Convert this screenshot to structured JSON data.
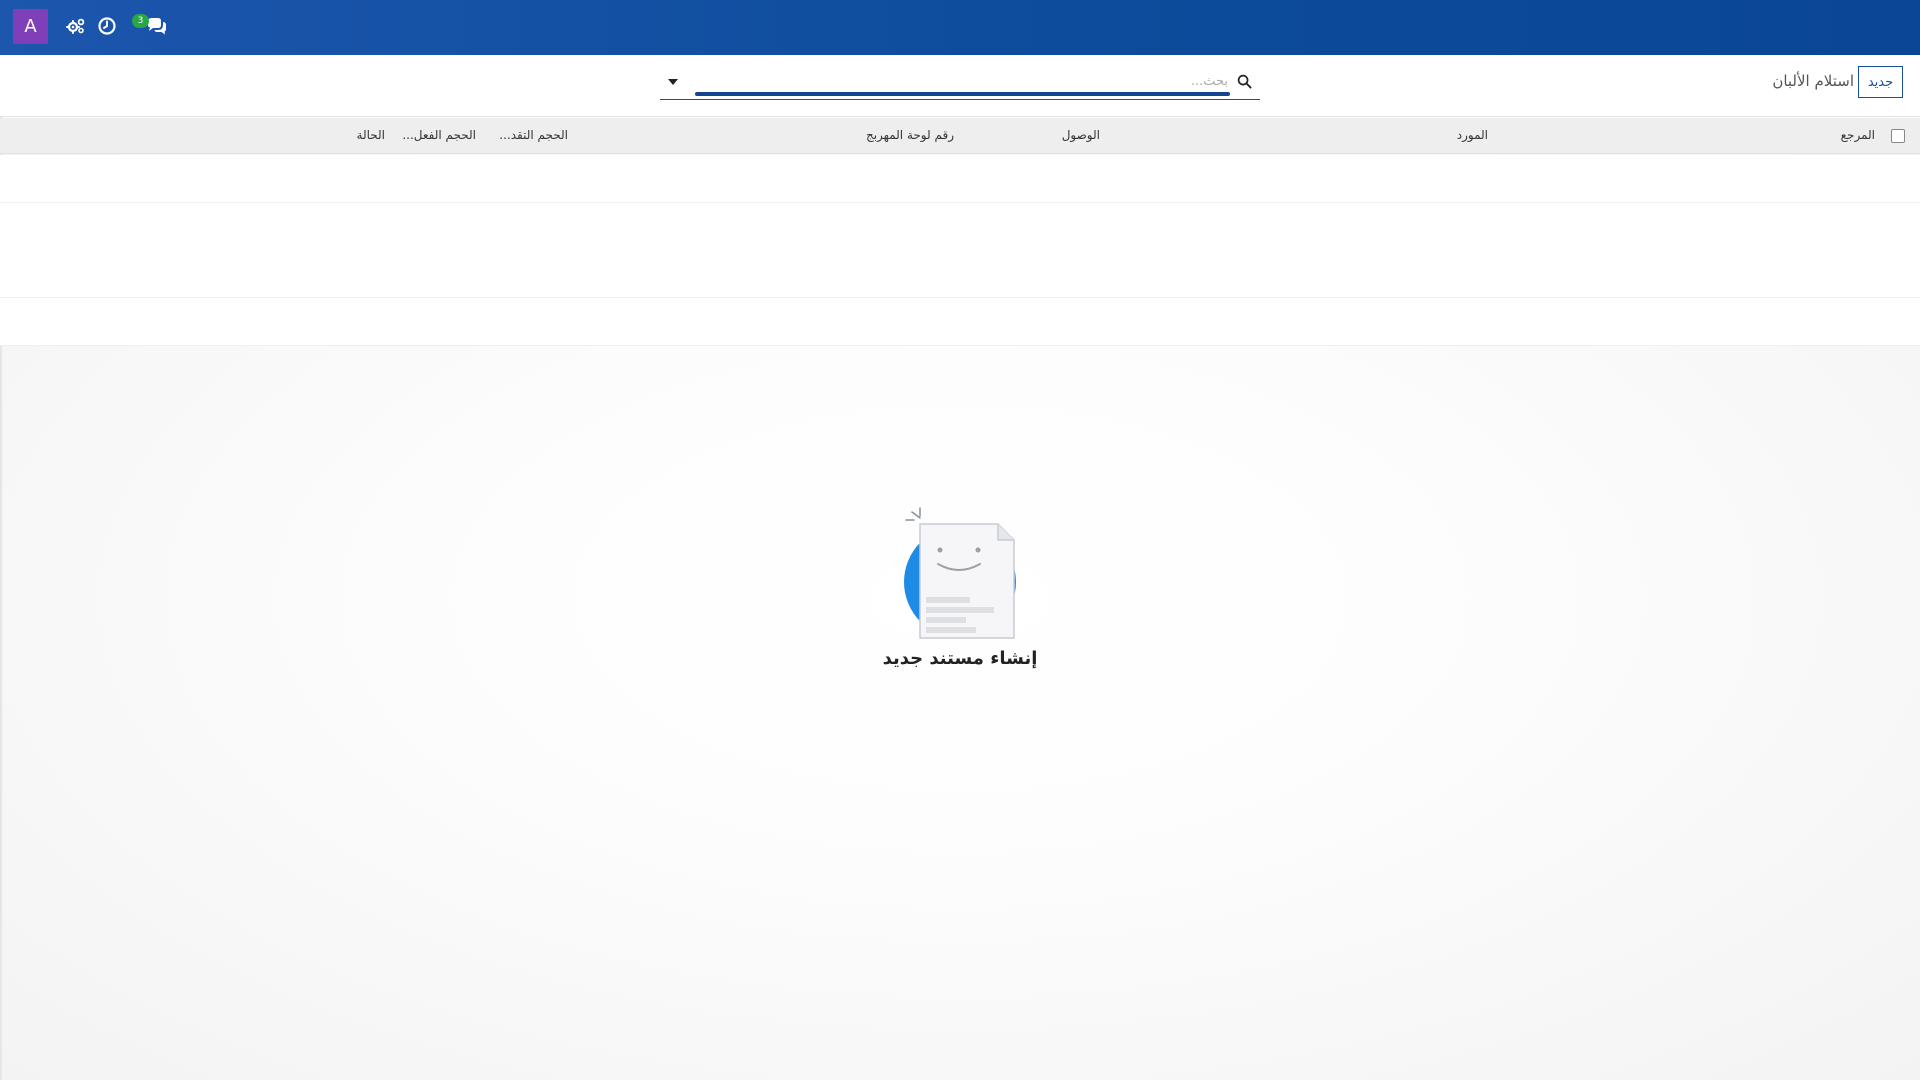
{
  "navbar": {
    "avatar_letter": "A",
    "chat_badge_count": "3",
    "icons": [
      "settings-gears-icon",
      "clock-icon",
      "chat-icon"
    ],
    "colors": {
      "bar": "#0d4c9c",
      "avatar": "#7e3fb8",
      "badge": "#28a745"
    }
  },
  "control_panel": {
    "new_button_label": "جديد",
    "breadcrumb": "استلام الألبان",
    "search_placeholder": "بحث..."
  },
  "table": {
    "columns": {
      "reference": "المرجع",
      "supplier": "المورد",
      "arrival": "الوصول",
      "refrigerator_plate": "رقم لوحة المهربج",
      "expected_volume": "الحجم التقد...",
      "actual_volume": "الحجم الفعل...",
      "status": "الحالة"
    },
    "empty_rows": 4
  },
  "help": {
    "title": "إنشاء مستند جديد"
  }
}
